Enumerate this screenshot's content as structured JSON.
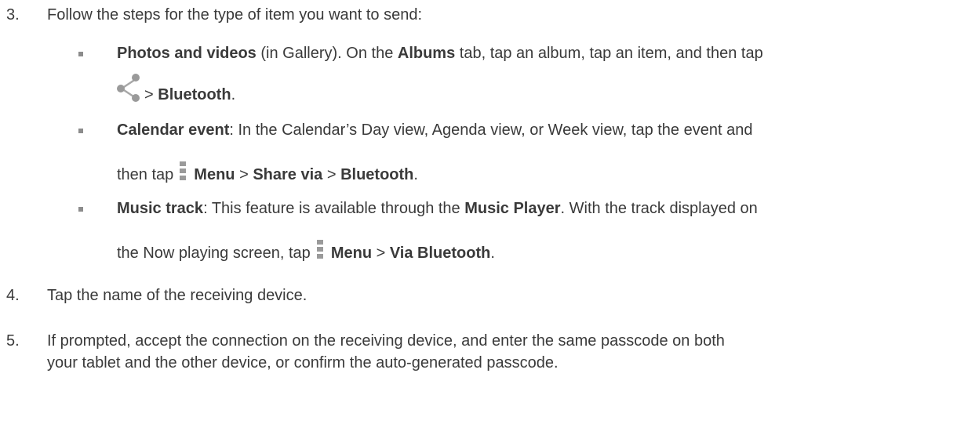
{
  "step3": {
    "number": "3.",
    "text": "Follow the steps for the type of item you want to send:"
  },
  "bullets": [
    {
      "bold1": "Photos and videos",
      "text1": " (in Gallery). On the ",
      "bold2": "Albums",
      "text2": " tab, tap an album, tap an item, and then tap",
      "line2_sep": "> ",
      "line2_bold": "Bluetooth",
      "line2_end": ".",
      "icon": "share-icon"
    },
    {
      "bold1": "Calendar event",
      "text1": ": In the Calendar’s Day view, Agenda view, or Week view, tap the event and",
      "line2_pre": "then tap",
      "line2_bold1": "Menu",
      "line2_sep1": " > ",
      "line2_bold2": "Share via",
      "line2_sep2": " > ",
      "line2_bold3": "Bluetooth",
      "line2_end": ".",
      "icon": "menu-icon"
    },
    {
      "bold1": "Music track",
      "text1": ": This feature is available through the ",
      "bold2": "Music Player",
      "text2": ". With the track displayed on",
      "line2_pre": "the Now playing screen, tap",
      "line2_bold1": "Menu",
      "line2_sep1": " > ",
      "line2_bold2": "Via Bluetooth",
      "line2_end": ".",
      "icon": "menu-icon"
    }
  ],
  "step4": {
    "number": "4.",
    "text": "Tap the name of the receiving device."
  },
  "step5": {
    "number": "5.",
    "line1": "If prompted, accept the connection on the receiving device, and enter the same passcode on both",
    "line2": "your tablet and the other device, or confirm the auto-generated passcode."
  }
}
